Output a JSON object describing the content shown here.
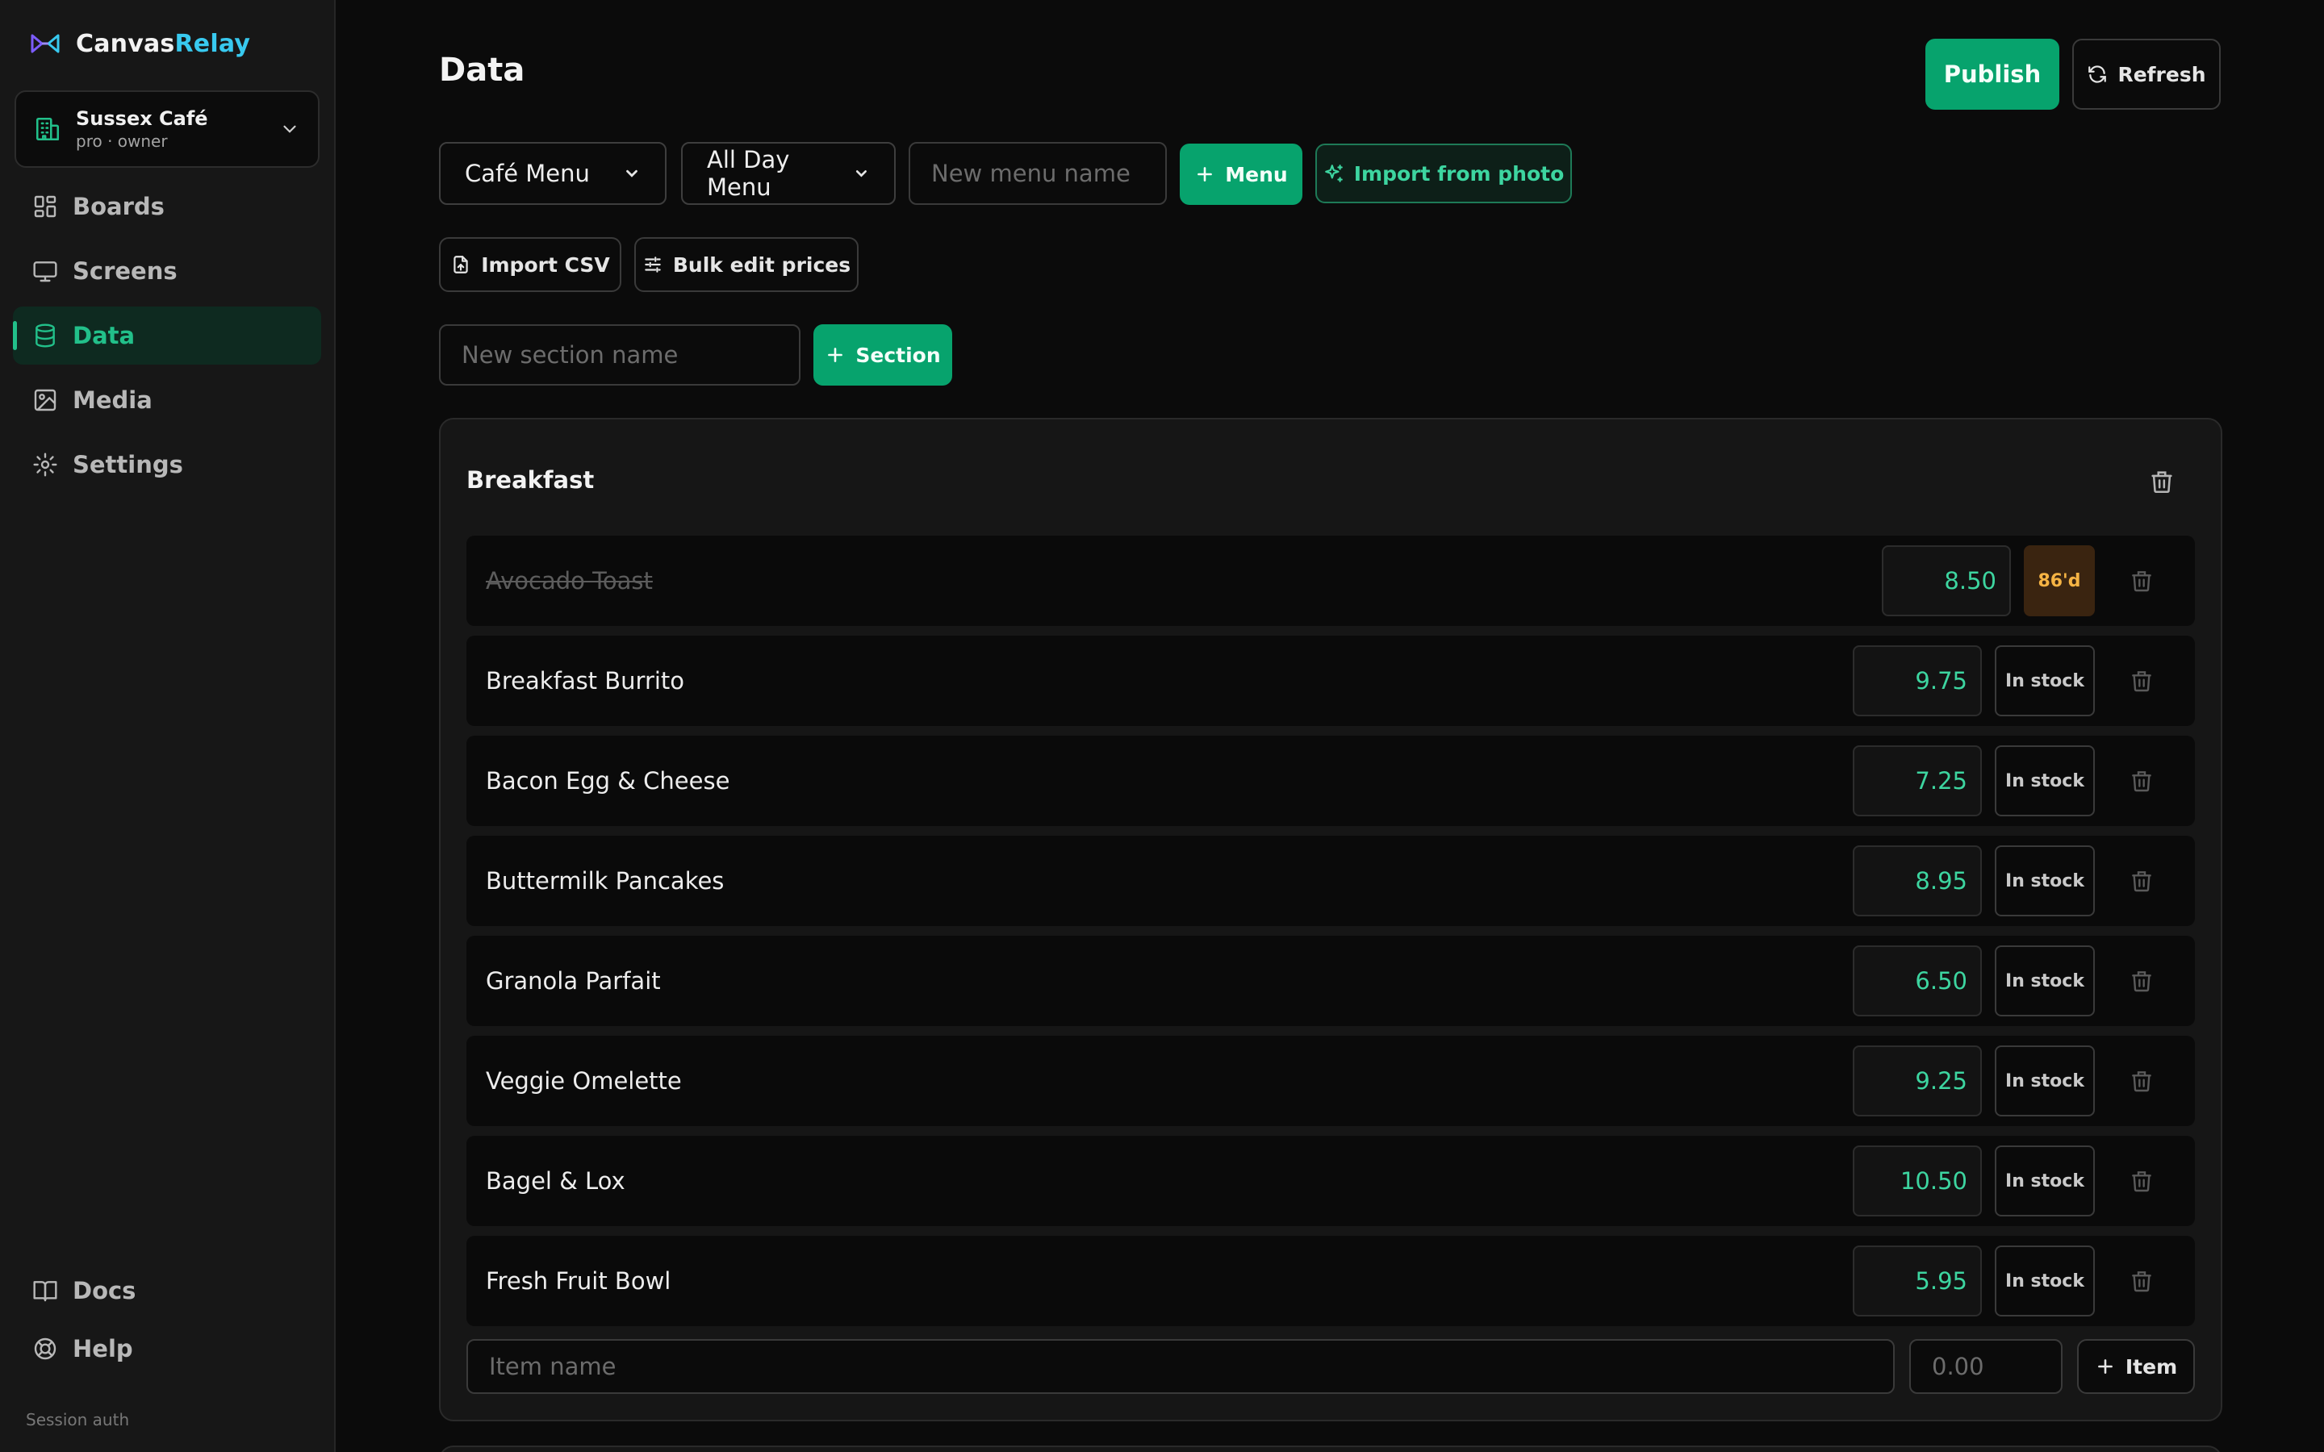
{
  "app": {
    "brand_part1": "Canvas",
    "brand_part2": "Relay",
    "accent": "#38c9ef",
    "primary": "#07a36d"
  },
  "org": {
    "name": "Sussex Café",
    "sub": "pro · owner"
  },
  "nav": [
    {
      "label": "Boards",
      "icon": "grid-icon",
      "active": false
    },
    {
      "label": "Screens",
      "icon": "monitor-icon",
      "active": false
    },
    {
      "label": "Data",
      "icon": "database-icon",
      "active": true
    },
    {
      "label": "Media",
      "icon": "image-icon",
      "active": false
    },
    {
      "label": "Settings",
      "icon": "gear-icon",
      "active": false
    }
  ],
  "nav_bottom": [
    {
      "label": "Docs",
      "icon": "book-icon"
    },
    {
      "label": "Help",
      "icon": "lifebuoy-icon"
    }
  ],
  "session": "Session auth",
  "page": {
    "title": "Data",
    "publish": "Publish",
    "refresh": "Refresh"
  },
  "toolbar": {
    "menu_select": "Café Menu",
    "variant_select": "All Day Menu",
    "new_menu_placeholder": "New menu name",
    "add_menu": "Menu",
    "import_photo": "Import from photo",
    "import_csv": "Import CSV",
    "bulk_edit": "Bulk edit prices",
    "new_section_placeholder": "New section name",
    "add_section": "Section"
  },
  "section": {
    "title": "Breakfast",
    "items": [
      {
        "name": "Avocado Toast",
        "price": "8.50",
        "stock": "86'd",
        "in_stock": false
      },
      {
        "name": "Breakfast Burrito",
        "price": "9.75",
        "stock": "In stock",
        "in_stock": true
      },
      {
        "name": "Bacon Egg & Cheese",
        "price": "7.25",
        "stock": "In stock",
        "in_stock": true
      },
      {
        "name": "Buttermilk Pancakes",
        "price": "8.95",
        "stock": "In stock",
        "in_stock": true
      },
      {
        "name": "Granola Parfait",
        "price": "6.50",
        "stock": "In stock",
        "in_stock": true
      },
      {
        "name": "Veggie Omelette",
        "price": "9.25",
        "stock": "In stock",
        "in_stock": true
      },
      {
        "name": "Bagel & Lox",
        "price": "10.50",
        "stock": "In stock",
        "in_stock": true
      },
      {
        "name": "Fresh Fruit Bowl",
        "price": "5.95",
        "stock": "In stock",
        "in_stock": true
      }
    ],
    "new_item_placeholder": "Item name",
    "new_price_placeholder": "0.00",
    "add_item": "Item"
  }
}
